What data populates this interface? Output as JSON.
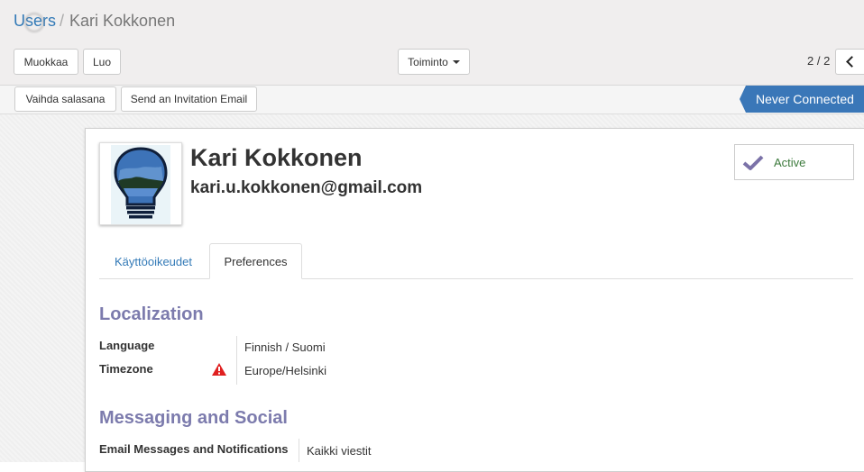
{
  "breadcrumb": {
    "parent": "Users",
    "separator": "/",
    "current": "Kari Kokkonen"
  },
  "toolbar": {
    "edit_label": "Muokkaa",
    "create_label": "Luo",
    "action_label": "Toiminto"
  },
  "pager": {
    "value": "2 / 2"
  },
  "header": {
    "change_password_label": "Vaihda salasana",
    "invite_label": "Send an Invitation Email",
    "status_label": "Never Connected"
  },
  "user": {
    "name": "Kari Kokkonen",
    "email": "kari.u.kokkonen@gmail.com"
  },
  "active_button": {
    "label": "Active"
  },
  "tabs": [
    {
      "label": "Käyttöoikeudet"
    },
    {
      "label": "Preferences"
    }
  ],
  "localization": {
    "title": "Localization",
    "language_label": "Language",
    "language_value": "Finnish / Suomi",
    "timezone_label": "Timezone",
    "timezone_value": "Europe/Helsinki"
  },
  "messaging": {
    "title": "Messaging and Social",
    "email_label": "Email Messages and Notifications",
    "email_value": "Kaikki viestit"
  },
  "icons": {
    "loading": "loading-spinner-icon",
    "dropdown": "caret-down-icon",
    "pager_prev": "chevron-left-icon",
    "active": "check-icon",
    "timezone_warning": "warning-icon"
  },
  "colors": {
    "link": "#337ab7",
    "status_active_bg": "#3a77b8",
    "section_title": "#7c7bad",
    "active_check": "#7b72a8",
    "warning": "#e02020"
  }
}
